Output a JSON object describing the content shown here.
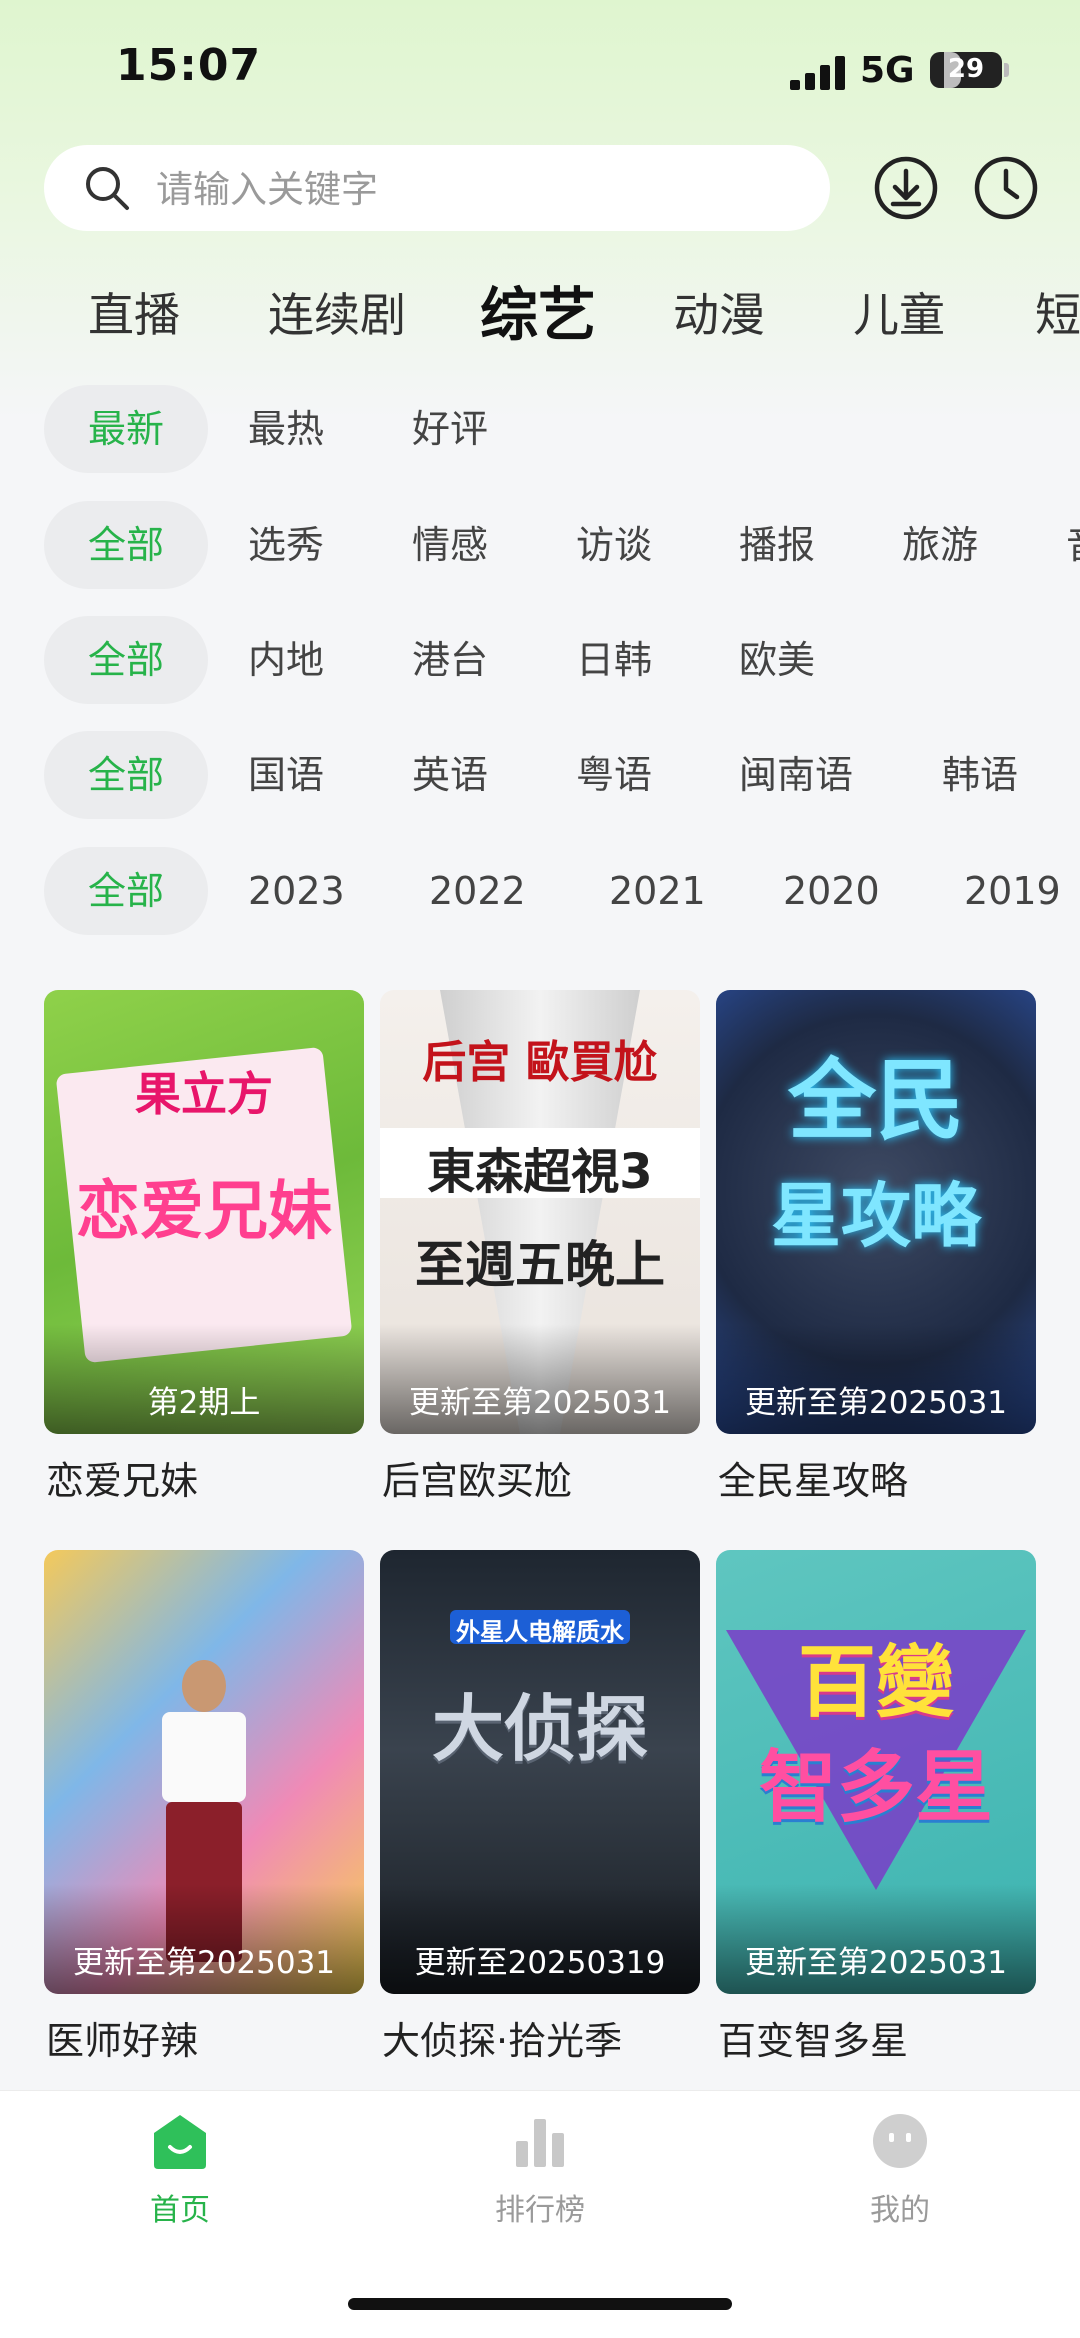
{
  "status_bar": {
    "time": "15:07",
    "network": "5G",
    "battery": 29
  },
  "search": {
    "placeholder": "请输入关键字"
  },
  "header_icons": [
    "download-icon",
    "history-clock-icon"
  ],
  "category_tabs": [
    {
      "label": "直播",
      "active": false
    },
    {
      "label": "连续剧",
      "active": false
    },
    {
      "label": "综艺",
      "active": true
    },
    {
      "label": "动漫",
      "active": false
    },
    {
      "label": "儿童",
      "active": false
    },
    {
      "label": "短",
      "active": false
    }
  ],
  "filters": {
    "sort": {
      "selected": "最新",
      "options": [
        "最热",
        "好评"
      ]
    },
    "genre": {
      "selected": "全部",
      "options": [
        "选秀",
        "情感",
        "访谈",
        "播报",
        "旅游",
        "音"
      ]
    },
    "region": {
      "selected": "全部",
      "options": [
        "内地",
        "港台",
        "日韩",
        "欧美"
      ]
    },
    "language": {
      "selected": "全部",
      "options": [
        "国语",
        "英语",
        "粤语",
        "闽南语",
        "韩语"
      ]
    },
    "year": {
      "selected": "全部",
      "options": [
        "2023",
        "2022",
        "2021",
        "2020",
        "2019"
      ]
    }
  },
  "shows": [
    {
      "title": "恋爱兄妹",
      "update": "第2期上",
      "poster_text": "恋爱兄妹",
      "poster_sub": "果立方"
    },
    {
      "title": "后宫欧买尬",
      "update": "更新至第2025031",
      "poster_text": "東森超視3",
      "poster_sub": "后宫 歐買尬",
      "poster_line3": "至週五晚上"
    },
    {
      "title": "全民星攻略",
      "update": "更新至第2025031",
      "poster_text": "全民",
      "poster_sub": "星攻略"
    },
    {
      "title": "医师好辣",
      "update": "更新至第2025031"
    },
    {
      "title": "大侦探·拾光季",
      "update": "更新至20250319",
      "poster_text": "大侦探",
      "poster_sub": "外星人电解质水"
    },
    {
      "title": "百变智多星",
      "update": "更新至第2025031",
      "poster_text": "百變",
      "poster_sub": "智多星"
    }
  ],
  "bottom_nav": [
    {
      "label": "首页",
      "active": true,
      "icon": "home-icon"
    },
    {
      "label": "排行榜",
      "active": false,
      "icon": "ranking-bar-icon"
    },
    {
      "label": "我的",
      "active": false,
      "icon": "profile-face-icon"
    }
  ],
  "colors": {
    "accent": "#27b34a",
    "chip_bg": "#ebecee",
    "top_gradient": "#dff5cf"
  }
}
